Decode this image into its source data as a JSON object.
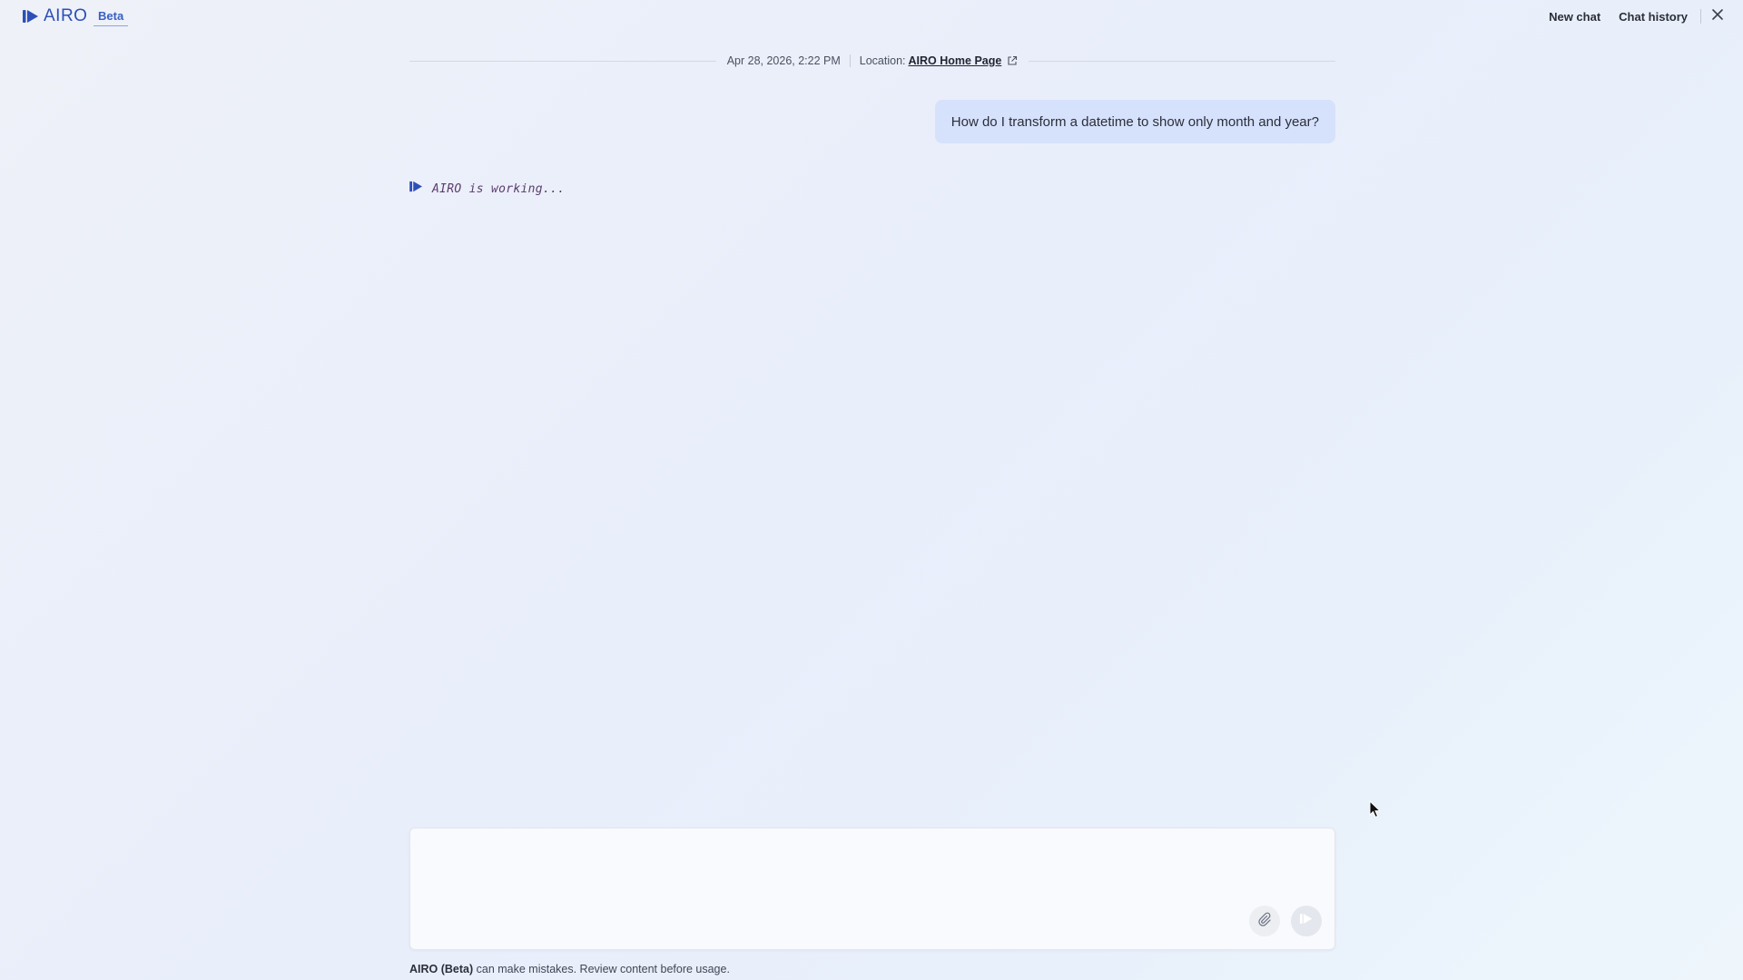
{
  "header": {
    "logo_text": "AIRO",
    "badge": "Beta",
    "new_chat_label": "New chat",
    "chat_history_label": "Chat history",
    "icons": {
      "logo": "airo-play-icon",
      "close": "close-icon"
    }
  },
  "conversation": {
    "timestamp": "Apr 28, 2026, 2:22 PM",
    "location_prefix": "Location:",
    "location_link": "AIRO Home Page",
    "user_message": "How do I transform a datetime to show only month and year?",
    "status_text": "AIRO is working..."
  },
  "composer": {
    "value": "",
    "placeholder": "",
    "icons": {
      "attach": "paperclip-icon",
      "send": "send-icon"
    }
  },
  "footer": {
    "disclaimer_bold": "AIRO (Beta)",
    "disclaimer_rest": " can make mistakes. Review content before usage."
  },
  "colors": {
    "brand": "#2d4fb7",
    "user_bubble": "#d6e1fb",
    "status_text": "#5a3b6e"
  }
}
